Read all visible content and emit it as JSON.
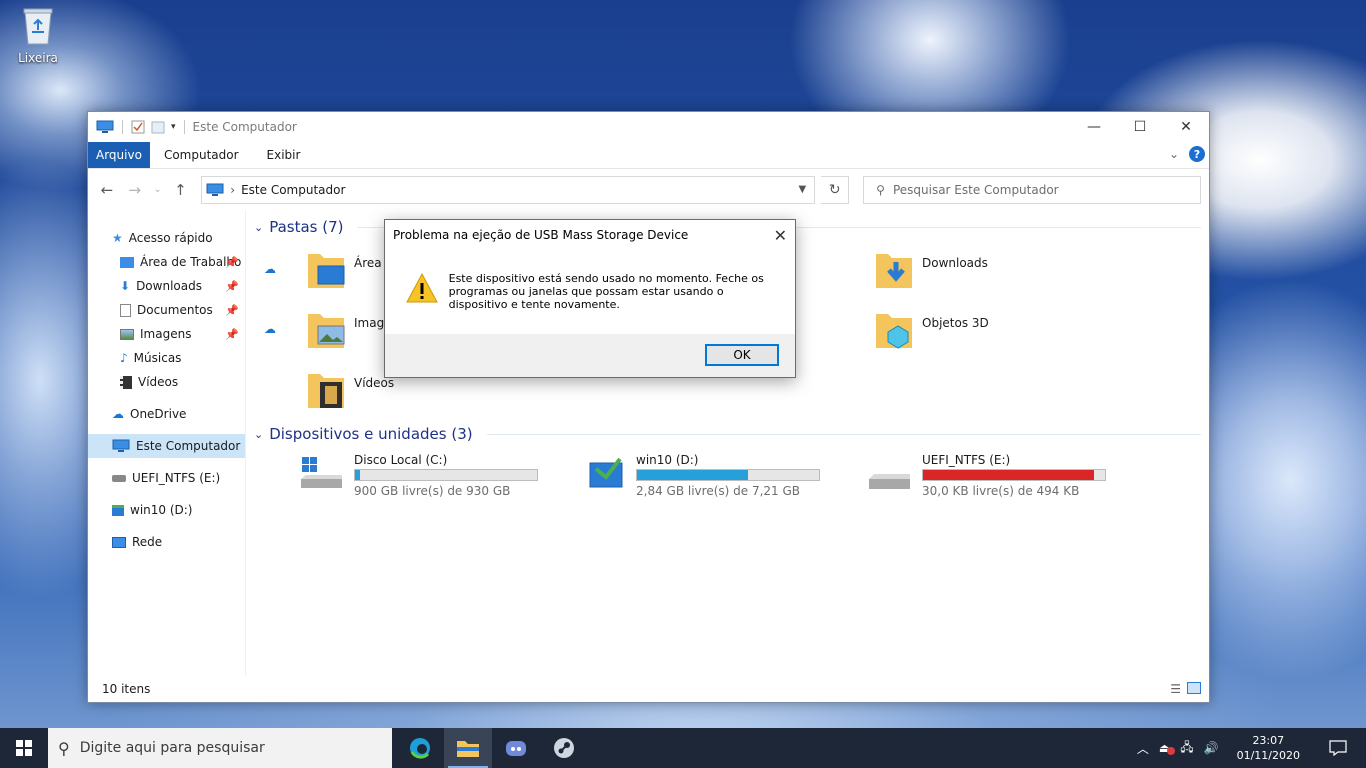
{
  "desktop": {
    "recycle_bin_label": "Lixeira"
  },
  "window": {
    "title": "Este Computador",
    "tabs": [
      "Arquivo",
      "Computador",
      "Exibir"
    ],
    "address_crumb": "Este Computador",
    "search_placeholder": "Pesquisar Este Computador",
    "status": "10 itens"
  },
  "sidebar": {
    "quick_access": "Acesso rápido",
    "items": [
      "Área de Trabalho",
      "Downloads",
      "Documentos",
      "Imagens",
      "Músicas",
      "Vídeos"
    ],
    "onedrive": "OneDrive",
    "this_pc": "Este Computador",
    "drive_e": "UEFI_NTFS (E:)",
    "drive_d": "win10 (D:)",
    "network": "Rede"
  },
  "folders": {
    "header": "Pastas (7)",
    "items": [
      "Área de Trabalho",
      "Imagens",
      "Vídeos",
      "Downloads",
      "Objetos 3D"
    ]
  },
  "devices": {
    "header": "Dispositivos e unidades (3)",
    "drives": [
      {
        "name": "Disco Local (C:)",
        "free": "900 GB livre(s) de 930 GB",
        "used_fraction": 0.03,
        "color": "#26a0da"
      },
      {
        "name": "win10 (D:)",
        "free": "2,84 GB livre(s) de 7,21 GB",
        "used_fraction": 0.61,
        "color": "#26a0da"
      },
      {
        "name": "UEFI_NTFS (E:)",
        "free": "30,0 KB livre(s) de 494 KB",
        "used_fraction": 0.94,
        "color": "#da2626"
      }
    ]
  },
  "dialog": {
    "title": "Problema na ejeção de USB Mass Storage Device",
    "message": "Este dispositivo está sendo usado no momento. Feche os programas ou janelas que possam estar usando o dispositivo e tente novamente.",
    "ok_label": "OK"
  },
  "taskbar": {
    "search_placeholder": "Digite aqui para pesquisar",
    "time": "23:07",
    "date": "01/11/2020"
  }
}
